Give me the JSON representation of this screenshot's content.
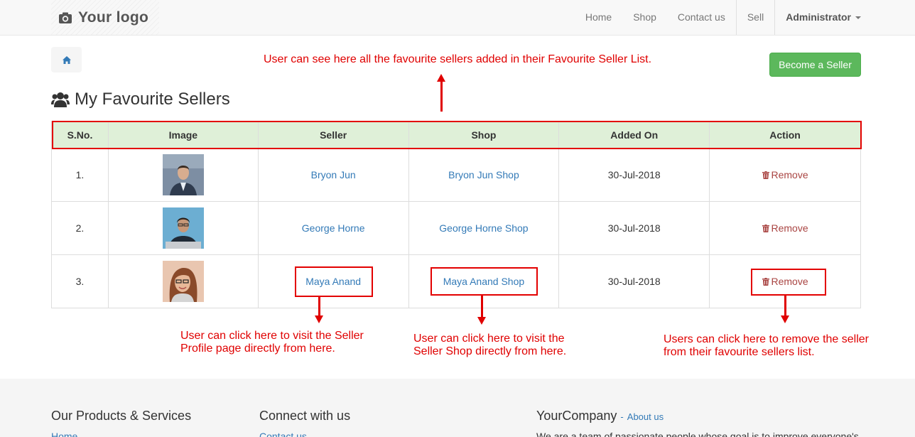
{
  "navbar": {
    "logo_text": "Your logo",
    "links": [
      "Home",
      "Shop",
      "Contact us"
    ],
    "sell": "Sell",
    "user": "Administrator"
  },
  "actions": {
    "become_seller": "Become a Seller"
  },
  "page": {
    "title": "My Favourite Sellers"
  },
  "table": {
    "headers": [
      "S.No.",
      "Image",
      "Seller",
      "Shop",
      "Added On",
      "Action"
    ],
    "rows": [
      {
        "sno": "1.",
        "seller": "Bryon Jun",
        "shop": "Bryon Jun Shop",
        "added_on": "30-Jul-2018",
        "action": "Remove"
      },
      {
        "sno": "2.",
        "seller": "George Horne",
        "shop": "George Horne Shop",
        "added_on": "30-Jul-2018",
        "action": "Remove"
      },
      {
        "sno": "3.",
        "seller": "Maya Anand",
        "shop": "Maya Anand Shop",
        "added_on": "30-Jul-2018",
        "action": "Remove"
      }
    ]
  },
  "annotations": {
    "top": "User can see here all the favourite sellers added in their Favourite Seller List.",
    "seller_l1": "User can click here to visit the Seller",
    "seller_l2": "Profile page directly from here.",
    "shop_l1": "User can click here to visit the",
    "shop_l2": "Seller Shop directly from here.",
    "remove_l1": "Users can click here to remove the seller",
    "remove_l2": "from their favourite sellers list."
  },
  "footer": {
    "col1_title": "Our Products & Services",
    "col1_link": "Home",
    "col2_title": "Connect with us",
    "col2_link": "Contact us",
    "col3_title": "YourCompany",
    "col3_about": "About us",
    "col3_text": "We are a team of passionate people whose goal is to improve everyone's"
  },
  "colors": {
    "accent": "#337ab7",
    "success": "#5cb85c",
    "danger": "#a94442",
    "annotation": "#e00000",
    "table_header": "#dff0d8"
  }
}
